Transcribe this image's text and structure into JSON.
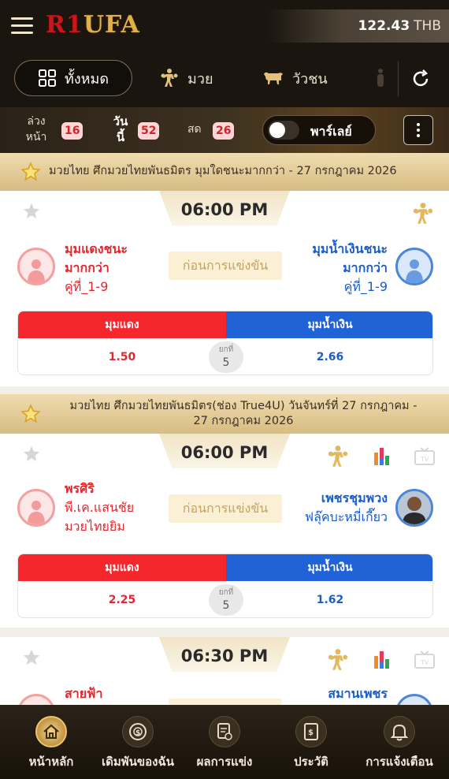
{
  "header": {
    "logo_part1": "R1",
    "logo_part2": "UFA",
    "balance": "122.43",
    "currency": "THB"
  },
  "categories": {
    "items": [
      {
        "label": "ทั้งหมด",
        "icon": "grid-icon",
        "active": true
      },
      {
        "label": "มวย",
        "icon": "boxer-icon",
        "active": false
      },
      {
        "label": "วัวชน",
        "icon": "bull-icon",
        "active": false
      }
    ],
    "refresh_icon": "refresh-icon"
  },
  "filters": {
    "advance_line1": "ล่วง",
    "advance_line2": "หน้า",
    "advance_count": "16",
    "today_line1": "วัน",
    "today_line2": "นี้",
    "today_count": "52",
    "live_label": "สด",
    "live_count": "26",
    "parlay_label": "พาร์เลย์"
  },
  "leagues": [
    {
      "title": "มวยไทย ศึกมวยไทยพันธมิตร มุมใดชนะมากกว่า - 27 กรกฎาคม 2026"
    },
    {
      "title_line1": "มวยไทย ศึกมวยไทยพันธมิตร(ช่อง True4U) วันจันทร์ที่ 27 กรกฎาคม -",
      "title_line2": "27 กรกฎาคม 2026"
    }
  ],
  "matches": [
    {
      "time": "06:00 PM",
      "red_line1": "มุมแดงชนะ",
      "red_line2": "มากกว่า",
      "red_line3": "คู่ที่_1-9",
      "blue_line1": "มุมน้ำเงินชนะ",
      "blue_line2": "มากกว่า",
      "blue_line3": "คู่ที่_1-9",
      "status": "ก่อนการแข่งขัน",
      "red_header": "มุมแดง",
      "blue_header": "มุมน้ำเงิน",
      "red_odds": "1.50",
      "blue_odds": "2.66",
      "round_label": "ยกที่",
      "round_value": "5"
    },
    {
      "time": "06:00 PM",
      "red_line1": "พรศิริ",
      "red_line2": "พี.เค.แสนชัย",
      "red_line3": "มวยไทยยิม",
      "blue_line1": "เพชรชุมพวง",
      "blue_line2": "ฟลุ๊คบะหมี่เกี๊ยว",
      "status": "ก่อนการแข่งขัน",
      "red_header": "มุมแดง",
      "blue_header": "มุมน้ำเงิน",
      "red_odds": "2.25",
      "blue_odds": "1.62",
      "round_label": "ยกที่",
      "round_value": "5"
    },
    {
      "time": "06:30 PM",
      "red_line1": "สายฟ้า",
      "blue_line1": "สมานเพชร"
    }
  ],
  "bottom_nav": [
    {
      "label": "หน้าหลัก",
      "icon": "home-icon",
      "active": true
    },
    {
      "label": "เดิมพันของฉัน",
      "icon": "chip-icon",
      "active": false
    },
    {
      "label": "ผลการแข่ง",
      "icon": "result-icon",
      "active": false
    },
    {
      "label": "ประวัติ",
      "icon": "history-icon",
      "active": false
    },
    {
      "label": "การแจ้งเตือน",
      "icon": "bell-icon",
      "active": false
    }
  ],
  "colors": {
    "red": "#f5262c",
    "blue": "#1f63d6",
    "gold": "#e0b04a",
    "dark": "#1b1510"
  }
}
